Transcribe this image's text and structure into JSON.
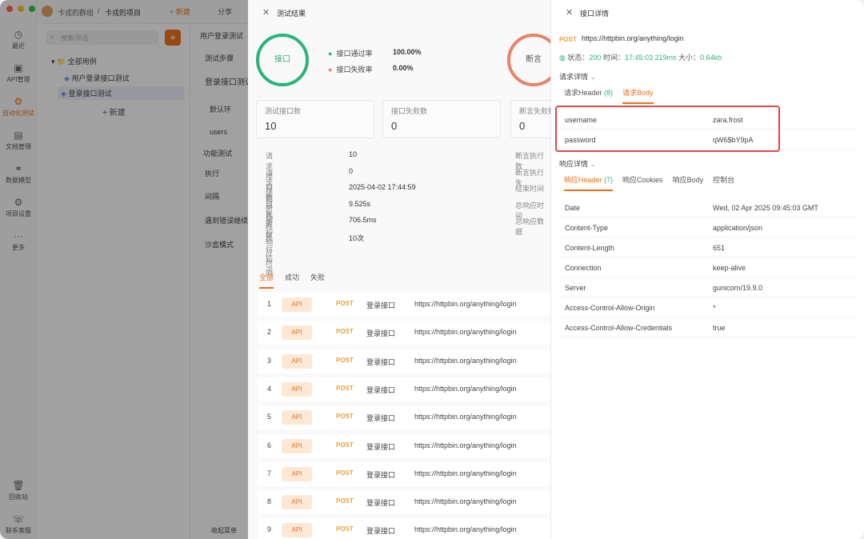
{
  "topbar": {
    "team": "卡戎的群组",
    "sep": "/",
    "project": "卡戎的项目",
    "new_label": "+ 新建",
    "share_label": "分享"
  },
  "nav": {
    "items": [
      {
        "label": "最近",
        "icon": "clock-icon"
      },
      {
        "label": "API管理",
        "icon": "api-icon"
      },
      {
        "label": "自动化测试",
        "icon": "automation-icon"
      },
      {
        "label": "文档管理",
        "icon": "doc-icon"
      },
      {
        "label": "数据模型",
        "icon": "model-icon"
      },
      {
        "label": "项目设置",
        "icon": "settings-icon"
      },
      {
        "label": "更多",
        "icon": "more-icon"
      },
      {
        "label": "回收站",
        "icon": "trash-icon"
      },
      {
        "label": "联系客服",
        "icon": "support-icon"
      }
    ]
  },
  "tree": {
    "search_placeholder": "搜索/筛选",
    "add": "+",
    "root": "全部用例",
    "items": [
      "用户登录接口测试",
      "登录接口测试"
    ],
    "new_label": "+ 新建"
  },
  "doc": {
    "tab": "用户登录测试",
    "steps_tab": "测试步骤",
    "heading": "登录接口测试",
    "default_label": "默认环",
    "users": "users",
    "func_test": "功能测试",
    "exec": "执行",
    "interval": "间隔",
    "on_error": "遇到错误继续",
    "sandbox": "沙盒模式",
    "collapse": "收起菜单"
  },
  "result": {
    "title": "测试结果",
    "ring_label": "接口",
    "ring2_label": "断言",
    "pass_rate_label": "接口通过率",
    "pass_rate": "100.00%",
    "fail_rate_label": "接口失败率",
    "fail_rate": "0.00%",
    "boxes": [
      {
        "label": "测试接口数",
        "value": "10"
      },
      {
        "label": "接口失败数",
        "value": "0"
      },
      {
        "label": "断言失败数",
        "value": "0"
      }
    ],
    "details": [
      {
        "k": "请求接口数",
        "v": "10"
      },
      {
        "k": "请求接口失败数",
        "v": "0"
      },
      {
        "k": "开始时间",
        "v": "2025-04-02 17:44:59"
      },
      {
        "k": "总耗时",
        "v": "9.525s"
      },
      {
        "k": "平均响应时间",
        "v": "706.5ms"
      },
      {
        "k": "执行轮次",
        "v": "10次"
      }
    ],
    "right_details": [
      "断言执行数",
      "断言执行失",
      "结束时间",
      "总响应时间",
      "总响应数据"
    ],
    "tabs": [
      "全部",
      "成功",
      "失败"
    ],
    "rows": [
      {
        "n": "1",
        "type": "API",
        "method": "POST",
        "name": "登录接口",
        "url": "https://httpbin.org/anything/login"
      },
      {
        "n": "2",
        "type": "API",
        "method": "POST",
        "name": "登录接口",
        "url": "https://httpbin.org/anything/login"
      },
      {
        "n": "3",
        "type": "API",
        "method": "POST",
        "name": "登录接口",
        "url": "https://httpbin.org/anything/login"
      },
      {
        "n": "4",
        "type": "API",
        "method": "POST",
        "name": "登录接口",
        "url": "https://httpbin.org/anything/login"
      },
      {
        "n": "5",
        "type": "API",
        "method": "POST",
        "name": "登录接口",
        "url": "https://httpbin.org/anything/login"
      },
      {
        "n": "6",
        "type": "API",
        "method": "POST",
        "name": "登录接口",
        "url": "https://httpbin.org/anything/login"
      },
      {
        "n": "7",
        "type": "API",
        "method": "POST",
        "name": "登录接口",
        "url": "https://httpbin.org/anything/login"
      },
      {
        "n": "8",
        "type": "API",
        "method": "POST",
        "name": "登录接口",
        "url": "https://httpbin.org/anything/login"
      },
      {
        "n": "9",
        "type": "API",
        "method": "POST",
        "name": "登录接口",
        "url": "https://httpbin.org/anything/login"
      }
    ]
  },
  "detail": {
    "title": "接口详情",
    "method": "POST",
    "url": "https://httpbin.org/anything/login",
    "status_label": "状态：",
    "status_code": "200",
    "time_label": "时间：",
    "time": "17:45:03",
    "duration": "219ms",
    "size_label": "大小：",
    "size": "0.64kb",
    "request_section": "请求详情",
    "request_tabs": [
      {
        "label": "请求Header",
        "count": "(8)"
      },
      {
        "label": "请求Body",
        "count": ""
      }
    ],
    "body": [
      {
        "k": "username",
        "v": "zara.frost"
      },
      {
        "k": "password",
        "v": "qW6$bY9pA"
      }
    ],
    "response_section": "响应详情",
    "response_tabs": [
      {
        "label": "响应Header",
        "count": "(7)"
      },
      {
        "label": "响应Cookies",
        "count": ""
      },
      {
        "label": "响应Body",
        "count": ""
      },
      {
        "label": "控制台",
        "count": ""
      }
    ],
    "headers": [
      {
        "k": "Date",
        "v": "Wed, 02 Apr 2025 09:45:03 GMT"
      },
      {
        "k": "Content-Type",
        "v": "application/json"
      },
      {
        "k": "Content-Length",
        "v": "651"
      },
      {
        "k": "Connection",
        "v": "keep-alive"
      },
      {
        "k": "Server",
        "v": "gunicorn/19.9.0"
      },
      {
        "k": "Access-Control-Allow-Origin",
        "v": "*"
      },
      {
        "k": "Access-Control-Allow-Credentials",
        "v": "true"
      }
    ]
  },
  "colors": {
    "accent": "#e8701a",
    "success": "#2cb37a",
    "fail": "#e8826a",
    "highlight": "#e04848"
  }
}
